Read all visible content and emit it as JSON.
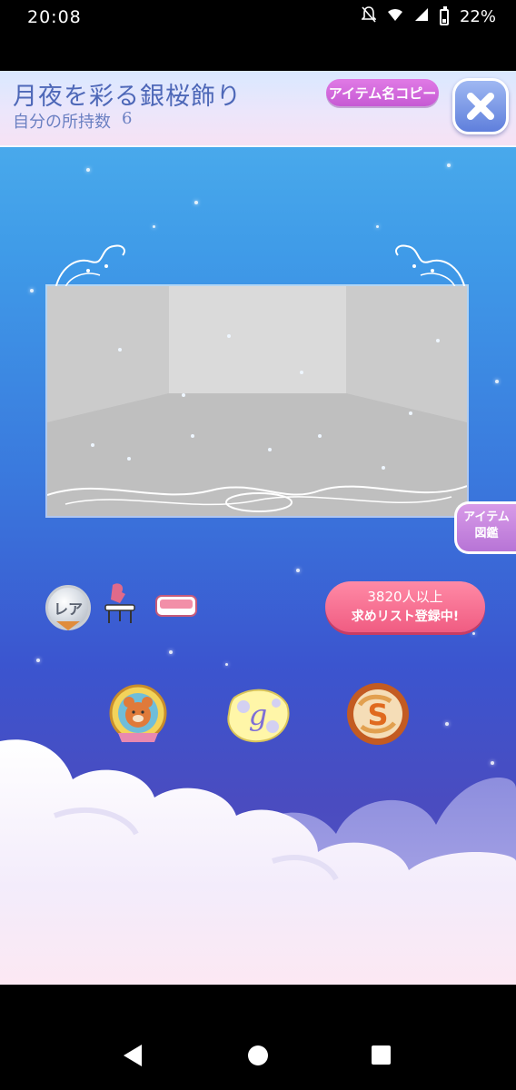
{
  "status_bar": {
    "time": "20:08",
    "battery": "22%",
    "icons": [
      "bell-off-icon",
      "wifi-icon",
      "signal-icon",
      "battery-icon"
    ]
  },
  "header": {
    "item_name": "月夜を彩る銀桜飾り",
    "owned_label": "自分の所持数",
    "owned_count": "6",
    "copy_button": "アイテム名コピー",
    "close_icon": "close-icon"
  },
  "side_button": {
    "line1": "アイテム",
    "line2": "図鑑"
  },
  "badges": {
    "rarity": "レア",
    "icons": [
      "rare-badge-icon",
      "furniture-icon",
      "cushion-icon"
    ]
  },
  "wish_list": {
    "count": "3820",
    "count_suffix": "人以上",
    "label": "求めリスト登録中!"
  },
  "currency_icons": [
    "bear-emblem-icon",
    "g-coin-icon",
    "s-coin-icon"
  ],
  "colors": {
    "accent_pink": "#f05c82",
    "accent_purple": "#c65ad4",
    "title_blue": "#4e68b8"
  },
  "nav": [
    "back-button",
    "home-button",
    "recents-button"
  ]
}
